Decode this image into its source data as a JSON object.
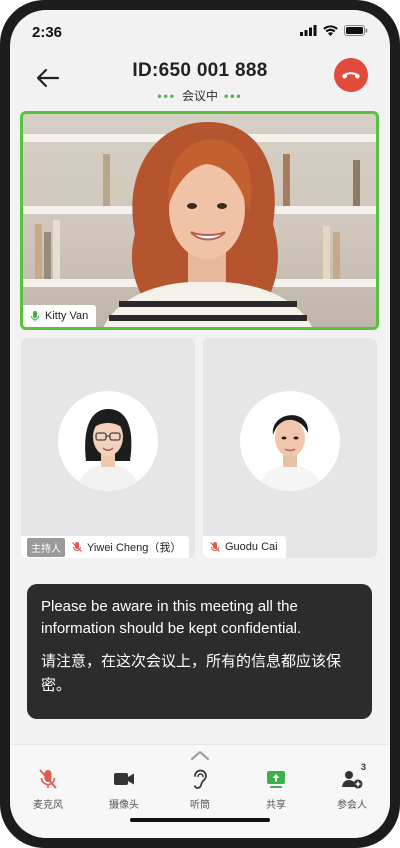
{
  "status_bar": {
    "time": "2:36"
  },
  "header": {
    "meeting_id": "ID:650 001 888",
    "meeting_status": "会议中",
    "status_color": "#4db34d",
    "hangup_color": "#e24a3b"
  },
  "main_video": {
    "participant_name": "Kitty Van",
    "active_speaker_border": "#58c23d",
    "mic_state": "on"
  },
  "participants": [
    {
      "name": "Yiwei Cheng（我）",
      "host_badge": "主持人",
      "mic_state": "muted"
    },
    {
      "name": "Guodu Cai",
      "mic_state": "muted"
    }
  ],
  "notice": {
    "text_en": "Please be aware in this meeting all the information should be kept confidential.",
    "text_zh": "请注意，在这次会议上，所有的信息都应该保密。"
  },
  "toolbar": {
    "items": [
      {
        "label": "麦克风",
        "icon": "mic-muted-icon"
      },
      {
        "label": "摄像头",
        "icon": "camera-icon"
      },
      {
        "label": "听筒",
        "icon": "ear-icon"
      },
      {
        "label": "共享",
        "icon": "share-screen-icon"
      },
      {
        "label": "参会人",
        "icon": "participants-icon",
        "badge": "3"
      }
    ],
    "accent_green": "#3cb34a",
    "muted_red": "#e05a4e"
  }
}
